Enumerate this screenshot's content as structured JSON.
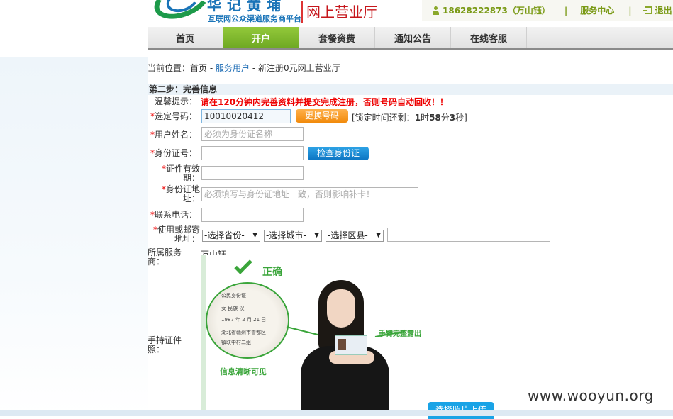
{
  "header": {
    "logo_big": "华记黄埔",
    "logo_sub": "互联网公众渠道服务商平台",
    "site_name": "网上营业厅",
    "user": "18628222873（万山钰）",
    "service_center": "服务中心",
    "logout": "退出",
    "separator": "|"
  },
  "nav": {
    "tabs": [
      {
        "label": "首页"
      },
      {
        "label": "开户"
      },
      {
        "label": "套餐资费"
      },
      {
        "label": "通知公告"
      },
      {
        "label": "在线客服"
      }
    ],
    "active_index": 1
  },
  "breadcrumb": {
    "prefix": "当前位置：",
    "home": "首页",
    "sep": " - ",
    "service_users": "服务用户",
    "current": "新注册0元网上营业厅"
  },
  "form": {
    "step_title": "第二步：完善信息",
    "tip_label": "温馨提示：",
    "tip_text": "请在120分钟内完善资料并提交完成注册，否则号码自动回收！！",
    "required_mark": "*",
    "number_label": "选定号码：",
    "number_value": "10010020412",
    "change_number_button": "更换号码",
    "lock_prefix": "[锁定时间还剩：",
    "lock_hours": "1",
    "lock_h_unit": "时",
    "lock_minutes": "58",
    "lock_m_unit": "分",
    "lock_seconds": "3",
    "lock_suffix": "秒]",
    "name_label": "用户姓名：",
    "name_placeholder": "必须为身份证名称",
    "id_label": "身份证号：",
    "check_id_button": "检查身份证",
    "validity_label_1": "证件有效",
    "validity_label_2": "期：",
    "address_label_1": "身份证地",
    "address_label_2": "址：",
    "address_placeholder": "必须填写与身份证地址一致，否则影响补卡！",
    "phone_label": "联系电话：",
    "mail_label_1": "使用或邮寄",
    "mail_label_2": "地址：",
    "province_select": "-选择省份-",
    "city_select": "-选择城市-",
    "district_select": "-选择区县-",
    "provider_label": "所属服务商：",
    "provider_value": "万山钰",
    "photo_label": "手持证件照：",
    "photo_correct": "正确",
    "photo_clear": "信息清晰可见",
    "photo_arm": "手臂完整露出",
    "upload_button": "选择照片上传"
  },
  "idcard": {
    "line1": "公民身份证",
    "line2": "女    民族 汉",
    "line3": "1987 年 2 月 21 日",
    "line4": "湖北省赣州市曾都区",
    "line5": "镇联中村二组"
  },
  "watermark": "www.wooyun.org",
  "colors": {
    "accent_green": "#7ab92e",
    "warning_red": "#e00000",
    "link_blue": "#1a6ab3"
  }
}
